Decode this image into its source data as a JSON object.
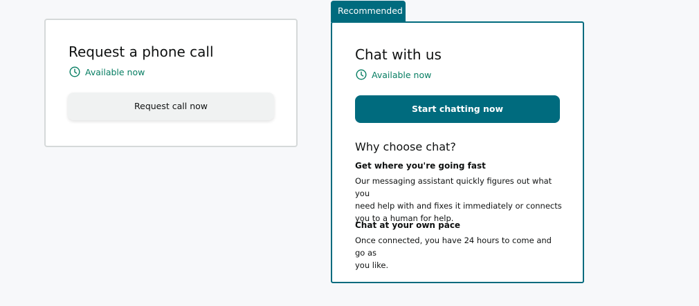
{
  "call_card": {
    "title": "Request a phone call",
    "availability": "Available now",
    "button_label": "Request call now"
  },
  "chat_card": {
    "badge": "Recommended",
    "title": "Chat with us",
    "availability": "Available now",
    "button_label": "Start chatting now",
    "why_heading": "Why choose chat?",
    "reasons": [
      {
        "title": "Get where you're going fast",
        "lines": [
          "Our messaging assistant quickly figures out what you",
          "need help with and fixes it immediately or connects",
          "you to a human for help."
        ]
      },
      {
        "title": "Chat at your own pace",
        "lines": [
          "Once connected, you have 24 hours to come and go as",
          "you like."
        ]
      }
    ]
  },
  "colors": {
    "accent_teal": "#006b7e",
    "available_green": "#067d62",
    "page_background": "#f7f8fa"
  },
  "icons": {
    "availability": "clock-icon"
  }
}
